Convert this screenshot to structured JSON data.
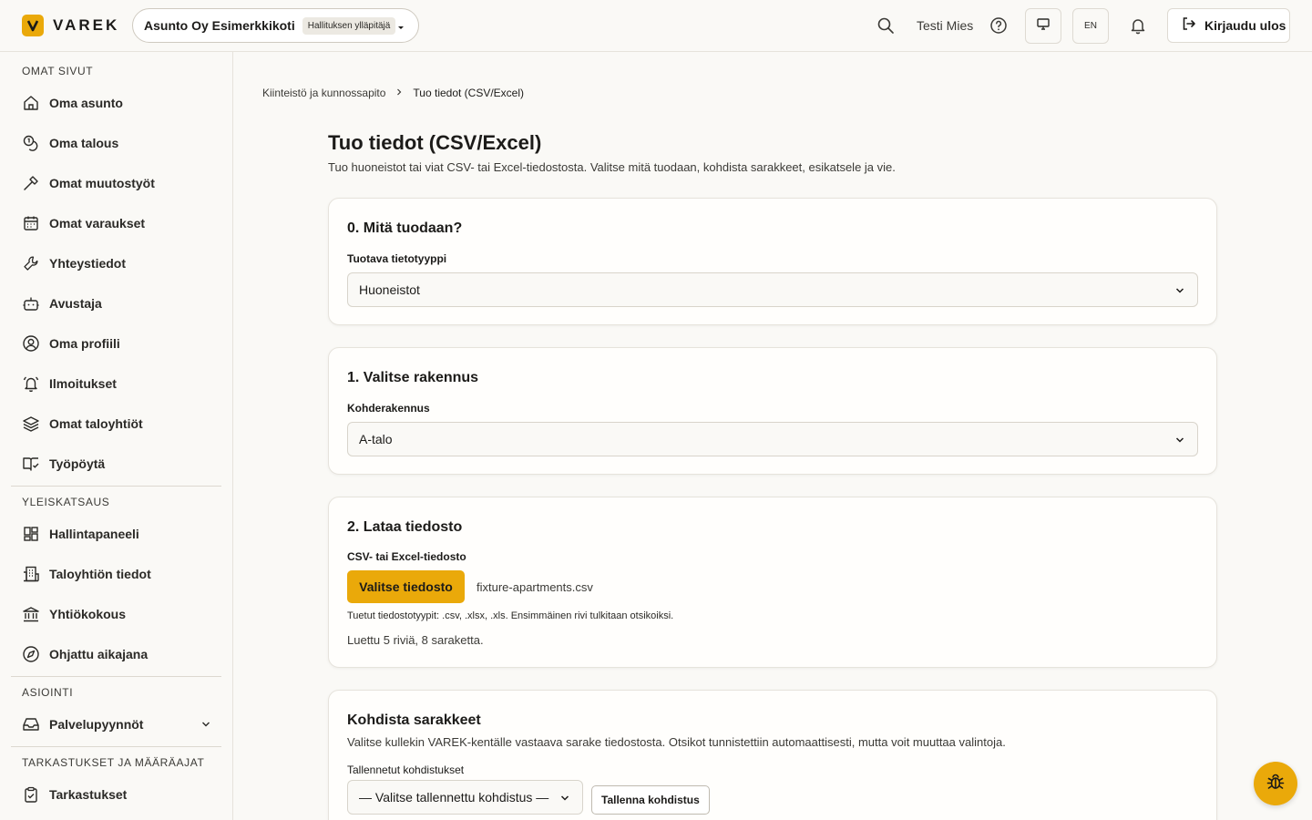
{
  "header": {
    "logo_text": "VAREK",
    "org_name": "Asunto Oy Esimerkkikoti",
    "org_role": "Hallituksen ylläpitäjä",
    "user_name": "Testi Mies",
    "lang": "EN",
    "logout_label": "Kirjaudu ulos"
  },
  "sidebar": {
    "sections": [
      {
        "title": "OMAT SIVUT",
        "items": [
          {
            "label": "Oma asunto",
            "icon": "home-icon"
          },
          {
            "label": "Oma talous",
            "icon": "coins-icon"
          },
          {
            "label": "Omat muutostyöt",
            "icon": "hammer-icon"
          },
          {
            "label": "Omat varaukset",
            "icon": "calendar-icon"
          },
          {
            "label": "Yhteystiedot",
            "icon": "wrench-icon"
          },
          {
            "label": "Avustaja",
            "icon": "bot-icon"
          },
          {
            "label": "Oma profiili",
            "icon": "user-circle-icon"
          },
          {
            "label": "Ilmoitukset",
            "icon": "bell-ring-icon"
          },
          {
            "label": "Omat taloyhtiöt",
            "icon": "layers-icon"
          },
          {
            "label": "Työpöytä",
            "icon": "book-check-icon"
          }
        ]
      },
      {
        "title": "YLEISKATSAUS",
        "items": [
          {
            "label": "Hallintapaneeli",
            "icon": "dashboard-icon"
          },
          {
            "label": "Taloyhtiön tiedot",
            "icon": "building-icon"
          },
          {
            "label": "Yhtiökokous",
            "icon": "landmark-icon"
          },
          {
            "label": "Ohjattu aikajana",
            "icon": "compass-icon"
          }
        ]
      },
      {
        "title": "ASIOINTI",
        "items": [
          {
            "label": "Palvelupyynnöt",
            "icon": "inbox-icon"
          }
        ]
      },
      {
        "title": "TARKASTUKSET JA MÄÄRÄAJAT",
        "items": [
          {
            "label": "Tarkastukset",
            "icon": "clipboard-check-icon"
          }
        ]
      }
    ]
  },
  "breadcrumb": {
    "parent": "Kiinteistö ja kunnossapito",
    "current": "Tuo tiedot (CSV/Excel)"
  },
  "page": {
    "title": "Tuo tiedot (CSV/Excel)",
    "description": "Tuo huoneistot tai viat CSV- tai Excel-tiedostosta. Valitse mitä tuodaan, kohdista sarakkeet, esikatsele ja vie."
  },
  "step0": {
    "title": "0. Mitä tuodaan?",
    "label": "Tuotava tietotyyppi",
    "value": "Huoneistot"
  },
  "step1": {
    "title": "1. Valitse rakennus",
    "label": "Kohderakennus",
    "value": "A-talo"
  },
  "step2": {
    "title": "2. Lataa tiedosto",
    "label": "CSV- tai Excel-tiedosto",
    "button": "Valitse tiedosto",
    "file_name": "fixture-apartments.csv",
    "hint": "Tuetut tiedostotyypit: .csv, .xlsx, .xls. Ensimmäinen rivi tulkitaan otsikoiksi.",
    "read_info": "Luettu 5 riviä, 8 saraketta."
  },
  "mapping": {
    "title": "Kohdista sarakkeet",
    "description": "Valitse kullekin VAREK-kentälle vastaava sarake tiedostosta. Otsikot tunnistettiin automaattisesti, mutta voit muuttaa valintoja.",
    "saved_label": "Tallennetut kohdistukset",
    "saved_placeholder": "— Valitse tallennettu kohdistus —",
    "save_button": "Tallenna kohdistus"
  },
  "colors": {
    "accent": "#eaa90a",
    "background": "#faf9f6",
    "card": "#fffefc",
    "border": "#e6e3dc"
  }
}
